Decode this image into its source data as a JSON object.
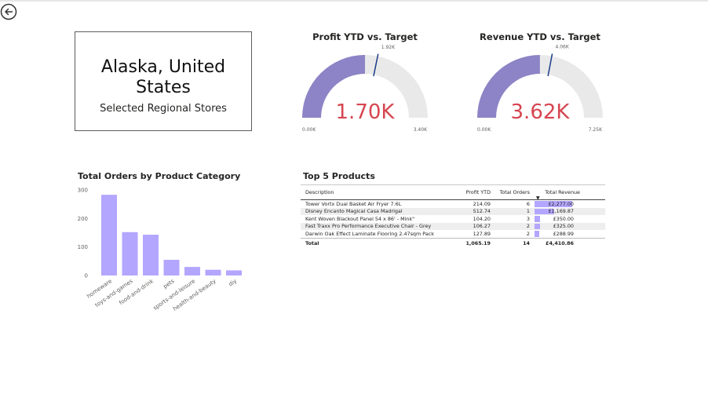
{
  "nav": {
    "back_icon": "back-arrow-circle-icon"
  },
  "location": {
    "title": "Alaska, United States",
    "subtitle": "Selected Regional Stores"
  },
  "gauges": [
    {
      "title": "Profit YTD vs. Target",
      "value_label": "1.70K",
      "min_label": "0.00K",
      "max_label": "3.40K",
      "target_label": "1.92K",
      "value": 1.7,
      "target": 1.92,
      "max": 3.4
    },
    {
      "title": "Revenue YTD vs. Target",
      "value_label": "3.62K",
      "min_label": "0.00K",
      "max_label": "7.25K",
      "target_label": "4.06K",
      "value": 3.62,
      "target": 4.06,
      "max": 7.25
    }
  ],
  "colors": {
    "gauge_fill": "#8c84c6",
    "gauge_track": "#e9e9e9",
    "target_line": "#1a3c8c",
    "value_text": "#d64550",
    "bar": "#b3a6ff"
  },
  "chart_data": {
    "type": "bar",
    "title": "Total Orders by Product Category",
    "categories": [
      "homeware",
      "toys-and-games",
      "food-and-drink",
      "pets",
      "sports-and-leisure",
      "health-and-beauty",
      "diy"
    ],
    "values": [
      283,
      152,
      143,
      55,
      30,
      20,
      18
    ],
    "ylim": [
      0,
      300
    ],
    "yticks": [
      0,
      100,
      200,
      300
    ],
    "xlabel": "",
    "ylabel": "",
    "grid": false
  },
  "top_products": {
    "title": "Top 5 Products",
    "headers": [
      "Description",
      "Profit YTD",
      "Total Orders",
      "Total Revenue"
    ],
    "rows": [
      {
        "desc": "Tower Vortx Dual Basket Air Fryer 7.6L",
        "profit": "214.09",
        "orders": "6",
        "revenue": "£2,277.00",
        "rev_value": 2277.0
      },
      {
        "desc": "Disney Encanto Magical Casa Madrigal",
        "profit": "512.74",
        "orders": "1",
        "revenue": "£1,169.87",
        "rev_value": 1169.87
      },
      {
        "desc": "Kent Woven Blackout Panel 54 x 86' - Mink\"",
        "profit": "104.20",
        "orders": "3",
        "revenue": "£350.00",
        "rev_value": 350.0
      },
      {
        "desc": "Fast Traxx Pro Performance Executive Chair - Grey",
        "profit": "106.27",
        "orders": "2",
        "revenue": "£325.00",
        "rev_value": 325.0
      },
      {
        "desc": "Darwin Oak Effect Laminate Flooring 2.47sqm Pack",
        "profit": "127.89",
        "orders": "2",
        "revenue": "£288.99",
        "rev_value": 288.99
      }
    ],
    "total": {
      "label": "Total",
      "profit": "1,065.19",
      "orders": "14",
      "revenue": "£4,410.86"
    }
  }
}
